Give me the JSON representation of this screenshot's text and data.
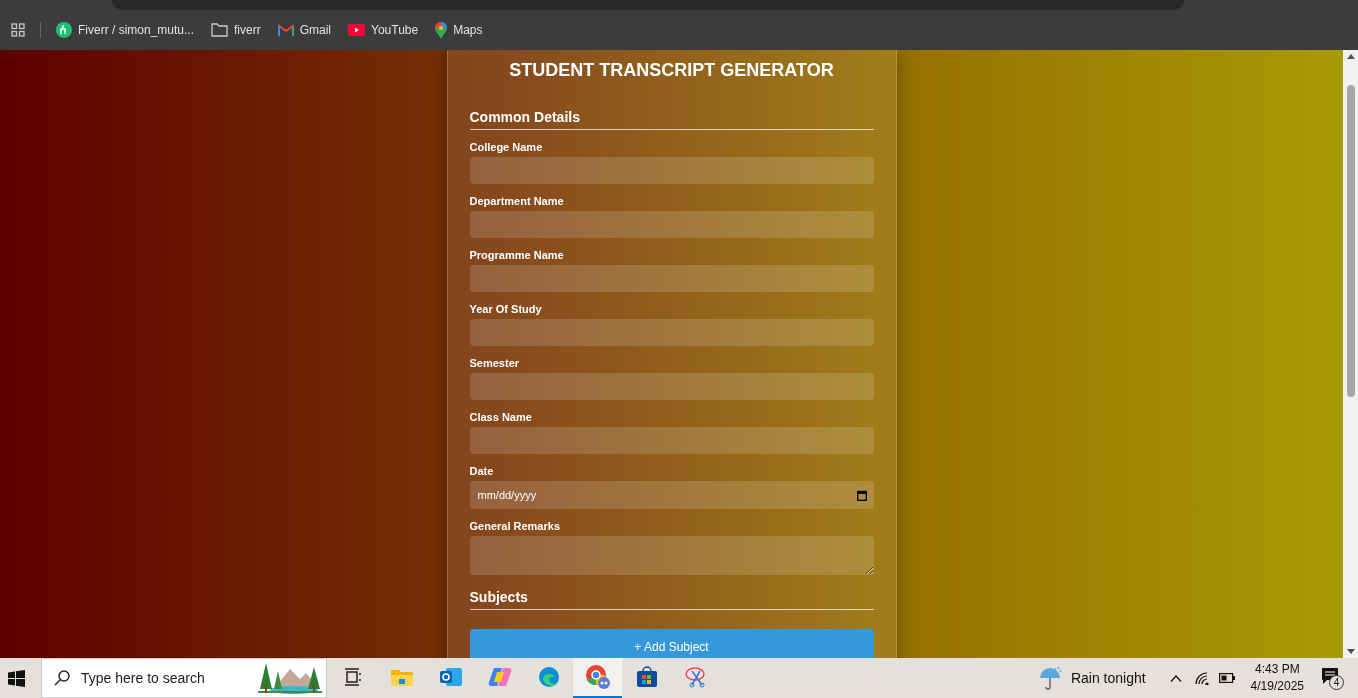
{
  "bookmarks": [
    {
      "kind": "site",
      "label": "Fiverr / simon_mutu..."
    },
    {
      "kind": "folder",
      "label": "fiverr"
    },
    {
      "kind": "gmail",
      "label": "Gmail"
    },
    {
      "kind": "youtube",
      "label": "YouTube"
    },
    {
      "kind": "maps",
      "label": "Maps"
    }
  ],
  "form": {
    "title": "STUDENT TRANSCRIPT GENERATOR",
    "sections": [
      {
        "heading": "Common Details",
        "fields": [
          {
            "kind": "text",
            "label": "College Name"
          },
          {
            "kind": "text",
            "label": "Department Name"
          },
          {
            "kind": "text",
            "label": "Programme Name"
          },
          {
            "kind": "text",
            "label": "Year Of Study"
          },
          {
            "kind": "text",
            "label": "Semester"
          },
          {
            "kind": "text",
            "label": "Class Name"
          },
          {
            "kind": "date",
            "label": "Date",
            "placeholder": "mm/dd/yyyy"
          },
          {
            "kind": "textarea",
            "label": "General Remarks"
          }
        ]
      },
      {
        "heading": "Subjects"
      }
    ],
    "add_button": "+ Add Subject"
  },
  "taskbar": {
    "search_placeholder": "Type here to search",
    "apps": [
      {
        "kind": "task-view",
        "selected": false
      },
      {
        "kind": "files",
        "selected": false
      },
      {
        "kind": "outlook",
        "selected": false
      },
      {
        "kind": "copilot",
        "selected": false
      },
      {
        "kind": "edge",
        "selected": false
      },
      {
        "kind": "chrome",
        "selected": true
      },
      {
        "kind": "store",
        "selected": false
      },
      {
        "kind": "snip",
        "selected": false
      }
    ],
    "weather": "Rain tonight",
    "time": "4:43 PM",
    "date": "4/19/2025",
    "notifications": "4"
  }
}
